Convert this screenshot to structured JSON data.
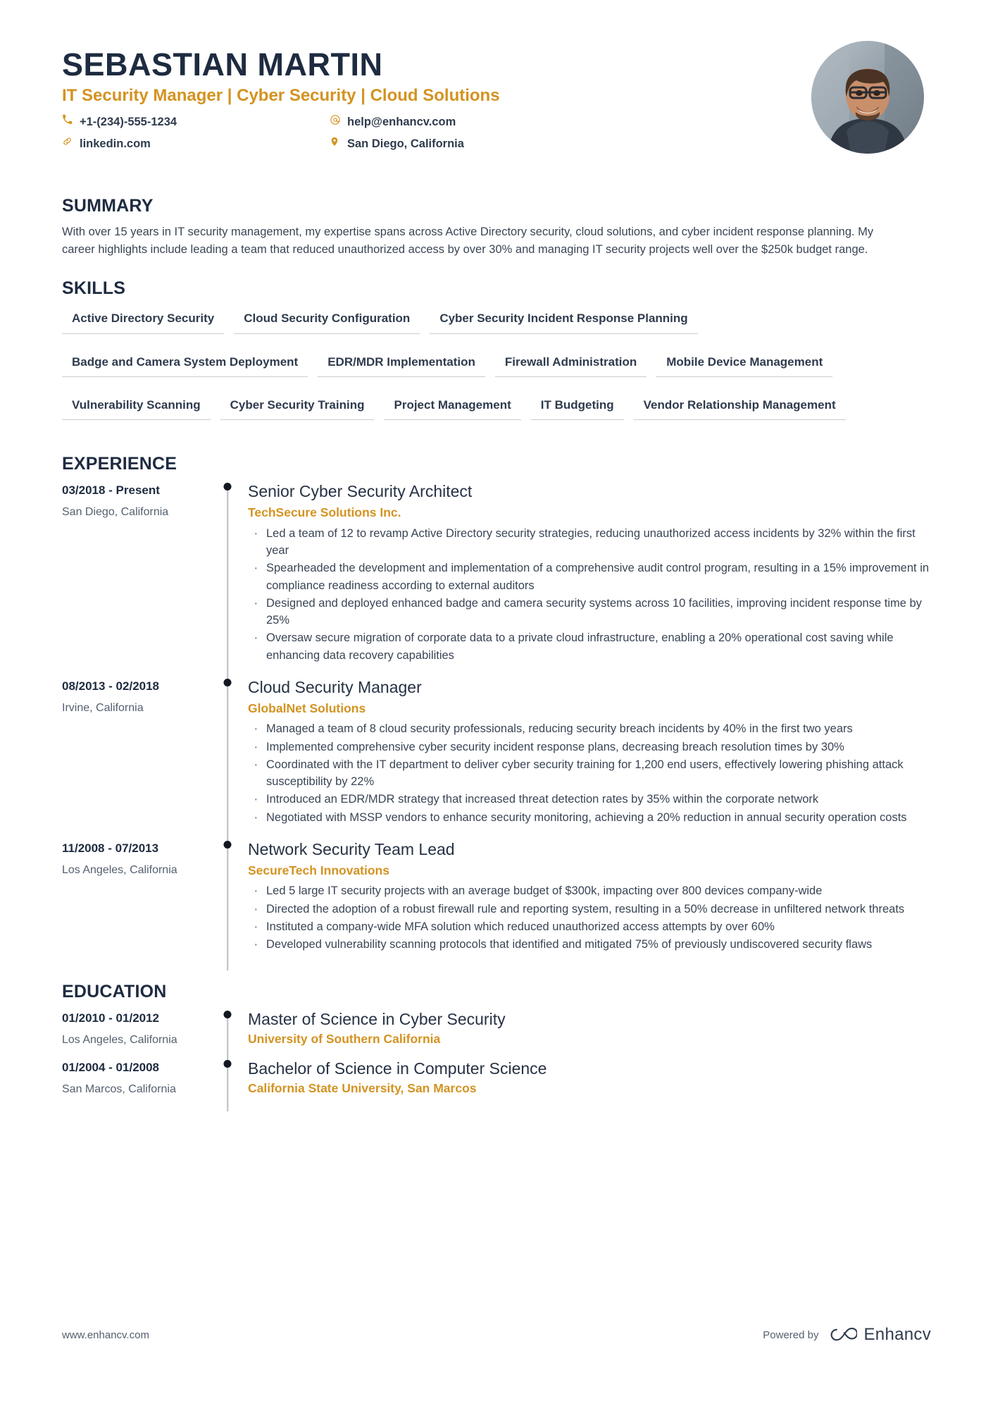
{
  "header": {
    "name": "SEBASTIAN MARTIN",
    "headline": "IT Security Manager | Cyber Security | Cloud Solutions",
    "contacts": [
      {
        "icon": "phone-icon",
        "value": "+1-(234)-555-1234"
      },
      {
        "icon": "email-icon",
        "value": "help@enhancv.com"
      },
      {
        "icon": "link-icon",
        "value": "linkedin.com"
      },
      {
        "icon": "location-pin-icon",
        "value": "San Diego, California"
      }
    ],
    "photo_alt": "profile-photo"
  },
  "summary": {
    "title": "SUMMARY",
    "text": "With over 15 years in IT security management, my expertise spans across Active Directory security, cloud solutions, and cyber incident response planning. My career highlights include leading a team that reduced unauthorized access by over 30% and managing IT security projects well over the $250k budget range."
  },
  "skills": {
    "title": "SKILLS",
    "items": [
      "Active Directory Security",
      "Cloud Security Configuration",
      "Cyber Security Incident Response Planning",
      "Badge and Camera System Deployment",
      "EDR/MDR Implementation",
      "Firewall Administration",
      "Mobile Device Management",
      "Vulnerability Scanning",
      "Cyber Security Training",
      "Project Management",
      "IT Budgeting",
      "Vendor Relationship Management"
    ]
  },
  "experience": {
    "title": "EXPERIENCE",
    "entries": [
      {
        "date": "03/2018 - Present",
        "location": "San Diego, California",
        "title": "Senior Cyber Security Architect",
        "organization": "TechSecure Solutions Inc.",
        "bullets": [
          "Led a team of 12 to revamp Active Directory security strategies, reducing unauthorized access incidents by 32% within the first year",
          "Spearheaded the development and implementation of a comprehensive audit control program, resulting in a 15% improvement in compliance readiness according to external auditors",
          "Designed and deployed enhanced badge and camera security systems across 10 facilities, improving incident response time by 25%",
          "Oversaw secure migration of corporate data to a private cloud infrastructure, enabling a 20% operational cost saving while enhancing data recovery capabilities"
        ]
      },
      {
        "date": "08/2013 - 02/2018",
        "location": "Irvine, California",
        "title": "Cloud Security Manager",
        "organization": "GlobalNet Solutions",
        "bullets": [
          "Managed a team of 8 cloud security professionals, reducing security breach incidents by 40% in the first two years",
          "Implemented comprehensive cyber security incident response plans, decreasing breach resolution times by 30%",
          "Coordinated with the IT department to deliver cyber security training for 1,200 end users, effectively lowering phishing attack susceptibility by 22%",
          "Introduced an EDR/MDR strategy that increased threat detection rates by 35% within the corporate network",
          "Negotiated with MSSP vendors to enhance security monitoring, achieving a 20% reduction in annual security operation costs"
        ]
      },
      {
        "date": "11/2008 - 07/2013",
        "location": "Los Angeles, California",
        "title": "Network Security Team Lead",
        "organization": "SecureTech Innovations",
        "bullets": [
          "Led 5 large IT security projects with an average budget of $300k, impacting over 800 devices company-wide",
          "Directed the adoption of a robust firewall rule and reporting system, resulting in a 50% decrease in unfiltered network threats",
          "Instituted a company-wide MFA solution which reduced unauthorized access attempts by over 60%",
          "Developed vulnerability scanning protocols that identified and mitigated 75% of previously undiscovered security flaws"
        ]
      }
    ]
  },
  "education": {
    "title": "EDUCATION",
    "entries": [
      {
        "date": "01/2010 - 01/2012",
        "location": "Los Angeles, California",
        "title": "Master of Science in Cyber Security",
        "organization": "University of Southern California"
      },
      {
        "date": "01/2004 - 01/2008",
        "location": "San Marcos, California",
        "title": "Bachelor of Science in Computer Science",
        "organization": "California State University, San Marcos"
      }
    ]
  },
  "footer": {
    "url": "www.enhancv.com",
    "powered_by": "Powered by",
    "brand_name": "Enhancv"
  },
  "colors": {
    "accent": "#d39321",
    "heading": "#1e2b40",
    "body_text": "#3a4555",
    "rail": "#b9bdc4",
    "dot": "#121720"
  }
}
